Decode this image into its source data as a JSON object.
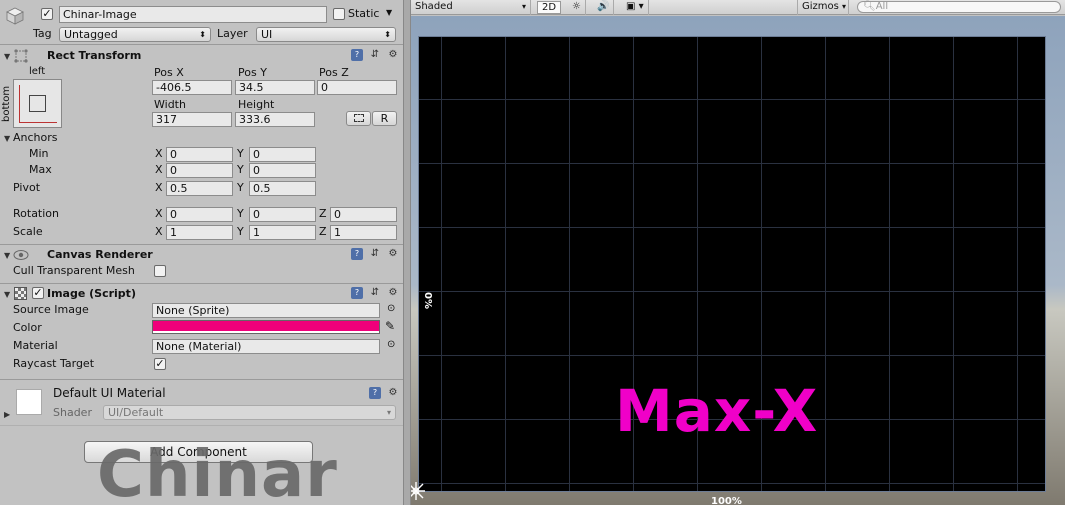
{
  "header": {
    "object_name": "Chinar-Image",
    "static_label": "Static",
    "tag_label": "Tag",
    "tag_value": "Untagged",
    "layer_label": "Layer",
    "layer_value": "UI"
  },
  "rect_transform": {
    "title": "Rect Transform",
    "anchor_left": "left",
    "anchor_bottom": "bottom",
    "pos_x_label": "Pos X",
    "pos_y_label": "Pos Y",
    "pos_z_label": "Pos Z",
    "pos_x": "-406.5",
    "pos_y": "34.5",
    "pos_z": "0",
    "width_label": "Width",
    "height_label": "Height",
    "width": "317",
    "height": "333.6",
    "r_button": "R",
    "anchors_label": "Anchors",
    "min_label": "Min",
    "max_label": "Max",
    "min_x": "0",
    "min_y": "0",
    "max_x": "0",
    "max_y": "0",
    "pivot_label": "Pivot",
    "pivot_x": "0.5",
    "pivot_y": "0.5",
    "rotation_label": "Rotation",
    "rot_x": "0",
    "rot_y": "0",
    "rot_z": "0",
    "scale_label": "Scale",
    "scale_x": "1",
    "scale_y": "1",
    "scale_z": "1",
    "x": "X",
    "y": "Y",
    "z": "Z"
  },
  "canvas_renderer": {
    "title": "Canvas Renderer",
    "cull_label": "Cull Transparent Mesh"
  },
  "image_script": {
    "title": "Image (Script)",
    "source_label": "Source Image",
    "source_value": "None (Sprite)",
    "color_label": "Color",
    "color_value": "#f0007a",
    "material_label": "Material",
    "material_value": "None (Material)",
    "raycast_label": "Raycast Target"
  },
  "material": {
    "name": "Default UI Material",
    "shader_label": "Shader",
    "shader_value": "UI/Default"
  },
  "add_component_label": "Add Component",
  "watermark": "Chinar",
  "scene": {
    "shading_mode": "Shaded",
    "mode_2d": "2D",
    "gizmos_label": "Gizmos",
    "search_placeholder": "All",
    "overlay_text": "Max-X",
    "percent_left": "0%",
    "percent_bottom": "100%"
  },
  "colors": {
    "overlay_magenta": "#f000c8",
    "image_color": "#f0007a"
  }
}
